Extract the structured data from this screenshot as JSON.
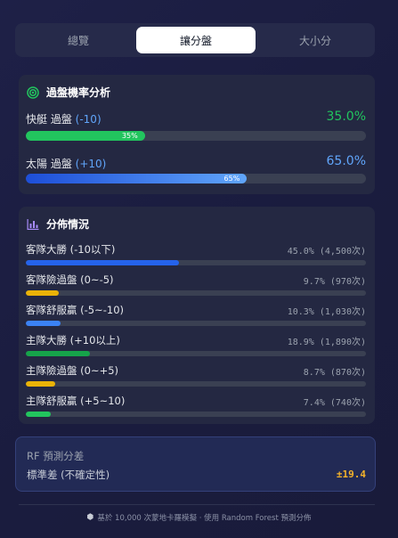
{
  "tabs": [
    {
      "label": "總覽",
      "active": false
    },
    {
      "label": "讓分盤",
      "active": true
    },
    {
      "label": "大小分",
      "active": false
    }
  ],
  "probability": {
    "title": "過盤機率分析",
    "icon": "target-icon",
    "rows": [
      {
        "team": "快艇 過盤",
        "line": "(-10)",
        "value": "35.0%",
        "bar_label": "35%",
        "percent": 35.0,
        "color": "#22c55e"
      },
      {
        "team": "太陽 過盤",
        "line": "(+10)",
        "value": "65.0%",
        "bar_label": "65%",
        "percent": 65.0,
        "color": "#3b82f6"
      }
    ]
  },
  "distribution": {
    "title": "分佈情況",
    "icon": "bar-chart-icon",
    "rows": [
      {
        "label": "客隊大勝 (-10以下)",
        "value": "45.0% (4,500次)",
        "percent": 45.0,
        "color": "#2563eb"
      },
      {
        "label": "客隊險過盤 (0~-5)",
        "value": "9.7% (970次)",
        "percent": 9.7,
        "color": "#eab308"
      },
      {
        "label": "客隊舒服贏 (-5~-10)",
        "value": "10.3% (1,030次)",
        "percent": 10.3,
        "color": "#3b82f6"
      },
      {
        "label": "主隊大勝 (+10以上)",
        "value": "18.9% (1,890次)",
        "percent": 18.9,
        "color": "#16a34a"
      },
      {
        "label": "主隊險過盤 (0~+5)",
        "value": "8.7% (870次)",
        "percent": 8.7,
        "color": "#eab308"
      },
      {
        "label": "主隊舒服贏 (+5~10)",
        "value": "7.4% (740次)",
        "percent": 7.4,
        "color": "#22c55e"
      }
    ]
  },
  "rf": {
    "title": "RF 預測分差",
    "label": "標準差 (不確定性)",
    "value": "±19.4"
  },
  "footer": {
    "icon": "cube-icon",
    "text": "基於 10,000 次蒙地卡羅模擬 · 使用 Random Forest 預測分佈"
  },
  "colors": {
    "accent_green": "#22c55e",
    "accent_blue": "#60a5fa",
    "accent_amber": "#f5b32a",
    "chart_icon": "#a78bfa"
  }
}
